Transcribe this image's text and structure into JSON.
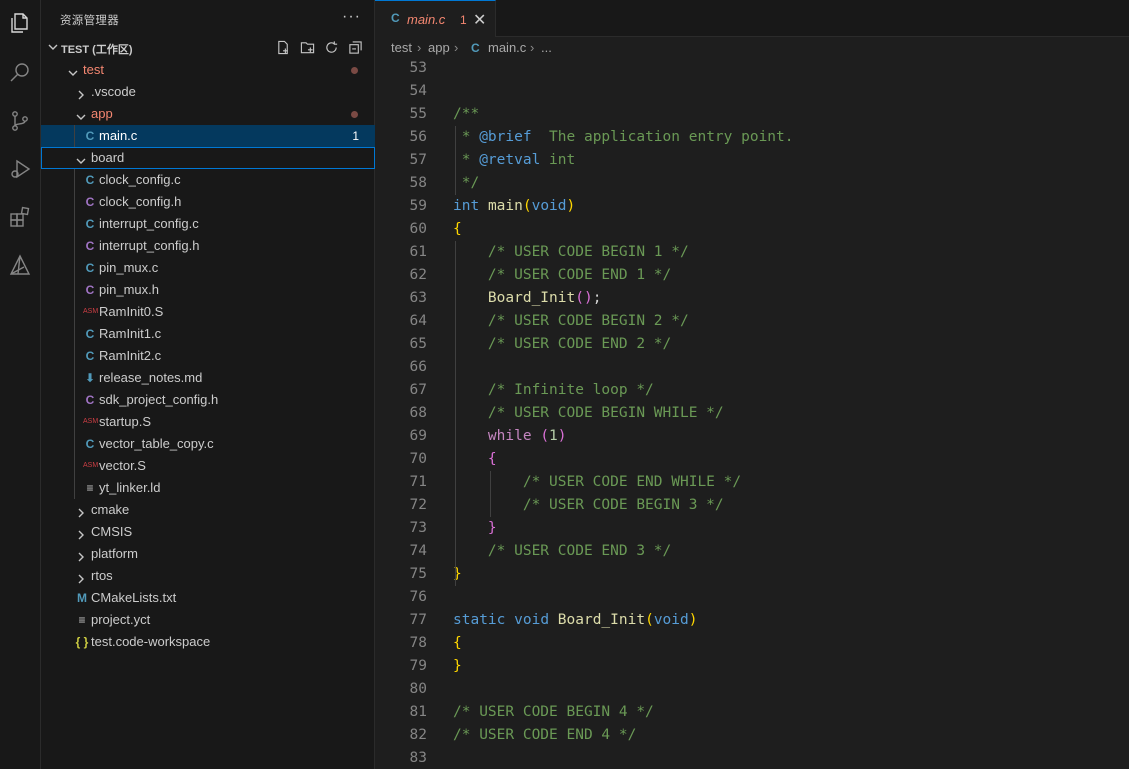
{
  "explorer": {
    "title": "资源管理器",
    "more": "···",
    "workspace_title": "TEST (工作区)"
  },
  "tree": [
    {
      "label": "test",
      "kind": "folder-open",
      "depth": 0,
      "status": "error",
      "dot": true
    },
    {
      "label": ".vscode",
      "kind": "folder-closed",
      "depth": 1
    },
    {
      "label": "app",
      "kind": "folder-open",
      "depth": 1,
      "status": "error",
      "dot": true
    },
    {
      "label": "main.c",
      "kind": "c",
      "depth": 2,
      "status": "error",
      "badge": "1",
      "selected": true
    },
    {
      "label": "board",
      "kind": "folder-open",
      "depth": 1,
      "focused": true
    },
    {
      "label": "clock_config.c",
      "kind": "c",
      "depth": 2
    },
    {
      "label": "clock_config.h",
      "kind": "h",
      "depth": 2
    },
    {
      "label": "interrupt_config.c",
      "kind": "c",
      "depth": 2
    },
    {
      "label": "interrupt_config.h",
      "kind": "h",
      "depth": 2
    },
    {
      "label": "pin_mux.c",
      "kind": "c",
      "depth": 2
    },
    {
      "label": "pin_mux.h",
      "kind": "h",
      "depth": 2
    },
    {
      "label": "RamInit0.S",
      "kind": "asm",
      "depth": 2
    },
    {
      "label": "RamInit1.c",
      "kind": "c",
      "depth": 2
    },
    {
      "label": "RamInit2.c",
      "kind": "c",
      "depth": 2
    },
    {
      "label": "release_notes.md",
      "kind": "md",
      "depth": 2
    },
    {
      "label": "sdk_project_config.h",
      "kind": "h",
      "depth": 2
    },
    {
      "label": "startup.S",
      "kind": "asm",
      "depth": 2
    },
    {
      "label": "vector_table_copy.c",
      "kind": "c",
      "depth": 2
    },
    {
      "label": "vector.S",
      "kind": "asm",
      "depth": 2
    },
    {
      "label": "yt_linker.ld",
      "kind": "list",
      "depth": 2
    },
    {
      "label": "cmake",
      "kind": "folder-closed",
      "depth": 1
    },
    {
      "label": "CMSIS",
      "kind": "folder-closed",
      "depth": 1
    },
    {
      "label": "platform",
      "kind": "folder-closed",
      "depth": 1
    },
    {
      "label": "rtos",
      "kind": "folder-closed",
      "depth": 1
    },
    {
      "label": "CMakeLists.txt",
      "kind": "m",
      "depth": 1
    },
    {
      "label": "project.yct",
      "kind": "list",
      "depth": 1
    },
    {
      "label": "test.code-workspace",
      "kind": "json",
      "depth": 1
    }
  ],
  "tab": {
    "icon": "C",
    "label": "main.c",
    "count": "1",
    "close": "✕"
  },
  "breadcrumb": {
    "parts": [
      "test",
      "app"
    ],
    "file_icon": "C",
    "file": "main.c",
    "tail": "..."
  },
  "icons": {
    "c": "C",
    "h": "C",
    "asm": "ASM",
    "md": "⬇",
    "m": "M",
    "list": "≡",
    "json": "{ }"
  },
  "colors": {
    "accent": "#0078d4",
    "selection": "#04395e",
    "error": "#f48771",
    "comment": "#6a9955",
    "keyword": "#569cd6",
    "function": "#dcdcaa"
  },
  "code": [
    {
      "n": "53",
      "t": [
        [
          "pl",
          ""
        ]
      ]
    },
    {
      "n": "54",
      "t": [
        [
          "pl",
          ""
        ]
      ]
    },
    {
      "n": "55",
      "t": [
        [
          "cm",
          "/**"
        ]
      ]
    },
    {
      "n": "56",
      "t": [
        [
          "cm",
          " * "
        ],
        [
          "doc",
          "@brief"
        ],
        [
          "cm",
          "  The application entry point."
        ]
      ]
    },
    {
      "n": "57",
      "t": [
        [
          "cm",
          " * "
        ],
        [
          "doc",
          "@retval"
        ],
        [
          "cm",
          " int"
        ]
      ]
    },
    {
      "n": "58",
      "t": [
        [
          "cm",
          " */"
        ]
      ]
    },
    {
      "n": "59",
      "t": [
        [
          "kw",
          "int"
        ],
        [
          "pl",
          " "
        ],
        [
          "fn",
          "main"
        ],
        [
          "b1",
          "("
        ],
        [
          "kw",
          "void"
        ],
        [
          "b1",
          ")"
        ]
      ]
    },
    {
      "n": "60",
      "t": [
        [
          "b1",
          "{"
        ]
      ]
    },
    {
      "n": "61",
      "t": [
        [
          "pl",
          "    "
        ],
        [
          "cm",
          "/* USER CODE BEGIN 1 */"
        ]
      ]
    },
    {
      "n": "62",
      "t": [
        [
          "pl",
          "    "
        ],
        [
          "cm",
          "/* USER CODE END 1 */"
        ]
      ]
    },
    {
      "n": "63",
      "t": [
        [
          "pl",
          "    "
        ],
        [
          "fn",
          "Board_Init"
        ],
        [
          "b2",
          "()"
        ],
        [
          "pl",
          ";"
        ]
      ]
    },
    {
      "n": "64",
      "t": [
        [
          "pl",
          "    "
        ],
        [
          "cm",
          "/* USER CODE BEGIN 2 */"
        ]
      ]
    },
    {
      "n": "65",
      "t": [
        [
          "pl",
          "    "
        ],
        [
          "cm",
          "/* USER CODE END 2 */"
        ]
      ]
    },
    {
      "n": "66",
      "t": [
        [
          "pl",
          ""
        ]
      ]
    },
    {
      "n": "67",
      "t": [
        [
          "pl",
          "    "
        ],
        [
          "cm",
          "/* Infinite loop */"
        ]
      ]
    },
    {
      "n": "68",
      "t": [
        [
          "pl",
          "    "
        ],
        [
          "cm",
          "/* USER CODE BEGIN WHILE */"
        ]
      ]
    },
    {
      "n": "69",
      "t": [
        [
          "pl",
          "    "
        ],
        [
          "ctl",
          "while"
        ],
        [
          "pl",
          " "
        ],
        [
          "b2",
          "("
        ],
        [
          "num",
          "1"
        ],
        [
          "b2",
          ")"
        ]
      ]
    },
    {
      "n": "70",
      "t": [
        [
          "pl",
          "    "
        ],
        [
          "b2",
          "{"
        ]
      ]
    },
    {
      "n": "71",
      "t": [
        [
          "pl",
          "        "
        ],
        [
          "cm",
          "/* USER CODE END WHILE */"
        ]
      ]
    },
    {
      "n": "72",
      "t": [
        [
          "pl",
          "        "
        ],
        [
          "cm",
          "/* USER CODE BEGIN 3 */"
        ]
      ]
    },
    {
      "n": "73",
      "t": [
        [
          "pl",
          "    "
        ],
        [
          "b2",
          "}"
        ]
      ]
    },
    {
      "n": "74",
      "t": [
        [
          "pl",
          "    "
        ],
        [
          "cm",
          "/* USER CODE END 3 */"
        ]
      ]
    },
    {
      "n": "75",
      "t": [
        [
          "b1",
          "}"
        ]
      ]
    },
    {
      "n": "76",
      "t": [
        [
          "pl",
          ""
        ]
      ]
    },
    {
      "n": "77",
      "t": [
        [
          "kw",
          "static"
        ],
        [
          "pl",
          " "
        ],
        [
          "kw",
          "void"
        ],
        [
          "pl",
          " "
        ],
        [
          "fn",
          "Board_Init"
        ],
        [
          "b1",
          "("
        ],
        [
          "kw",
          "void"
        ],
        [
          "b1",
          ")"
        ]
      ]
    },
    {
      "n": "78",
      "t": [
        [
          "b1",
          "{"
        ]
      ]
    },
    {
      "n": "79",
      "t": [
        [
          "b1",
          "}"
        ]
      ]
    },
    {
      "n": "80",
      "t": [
        [
          "pl",
          ""
        ]
      ]
    },
    {
      "n": "81",
      "t": [
        [
          "cm",
          "/* USER CODE BEGIN 4 */"
        ]
      ]
    },
    {
      "n": "82",
      "t": [
        [
          "cm",
          "/* USER CODE END 4 */"
        ]
      ]
    },
    {
      "n": "83",
      "t": [
        [
          "pl",
          ""
        ]
      ]
    }
  ]
}
